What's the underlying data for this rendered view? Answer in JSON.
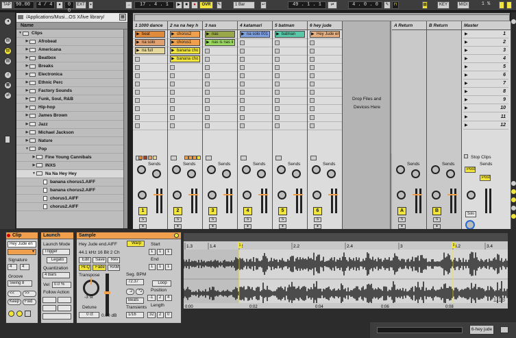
{
  "transport": {
    "tap": "TAP",
    "tempo": "90.00",
    "signature": "4 / 4",
    "metro_icon": "metronome-icon",
    "follow": "0 0",
    "ext": "EXT",
    "arr_position": "17 .  4 .  1",
    "ovr": "OVR",
    "quantize": "1 Bar",
    "loop_start": "49 .  1 .  1",
    "loop_len": "4 .  0 .  0",
    "key": "KEY",
    "midi": "MIDI",
    "cpu": "1 %",
    "colors": {
      "accent": "#f1e43c",
      "orange": "#f0a04c",
      "mixer_bg": "#9e9e9e"
    }
  },
  "browser": {
    "path": "/Applications/Musi...OS X/live library/",
    "column_header": "Name",
    "items": [
      {
        "label": "Clips",
        "type": "folder",
        "level": 0,
        "open": true
      },
      {
        "label": "Afrobeat",
        "type": "folder",
        "level": 1,
        "open": false
      },
      {
        "label": "Americana",
        "type": "folder",
        "level": 1,
        "open": false
      },
      {
        "label": "Beatbox",
        "type": "folder",
        "level": 1,
        "open": false
      },
      {
        "label": "Breaks",
        "type": "folder",
        "level": 1,
        "open": false
      },
      {
        "label": "Electronica",
        "type": "folder",
        "level": 1,
        "open": false
      },
      {
        "label": "Ethnic Perc",
        "type": "folder",
        "level": 1,
        "open": false
      },
      {
        "label": "Factory Sounds",
        "type": "folder",
        "level": 1,
        "open": false
      },
      {
        "label": "Funk, Soul, R&B",
        "type": "folder",
        "level": 1,
        "open": false
      },
      {
        "label": "Hip-hop",
        "type": "folder",
        "level": 1,
        "open": false
      },
      {
        "label": "James Brown",
        "type": "folder",
        "level": 1,
        "open": false
      },
      {
        "label": "Jazz",
        "type": "folder",
        "level": 1,
        "open": false
      },
      {
        "label": "Michael Jackson",
        "type": "folder",
        "level": 1,
        "open": false
      },
      {
        "label": "Nature",
        "type": "folder",
        "level": 1,
        "open": false
      },
      {
        "label": "Pop",
        "type": "folder",
        "level": 1,
        "open": true
      },
      {
        "label": "Fine Young Cannibals",
        "type": "folder",
        "level": 2,
        "open": false
      },
      {
        "label": "INXS",
        "type": "folder",
        "level": 2,
        "open": false
      },
      {
        "label": "Na Na Hey Hey",
        "type": "folder",
        "level": 2,
        "open": true,
        "selected": true
      },
      {
        "label": "banana chorus1.AIFF",
        "type": "file",
        "level": 3
      },
      {
        "label": "banana chorus2.AIFF",
        "type": "file",
        "level": 3
      },
      {
        "label": "chorus1.AIFF",
        "type": "file",
        "level": 3
      },
      {
        "label": "chorus2.AIFF",
        "type": "file",
        "level": 3
      }
    ]
  },
  "session": {
    "tracks": [
      {
        "name": "1 1000 dance",
        "num": "1",
        "clips": [
          {
            "label": "beat",
            "color": "#e08a3c"
          },
          {
            "label": "na solo",
            "color": "#e0a070"
          },
          {
            "label": "na full",
            "color": "#e6d89a"
          }
        ]
      },
      {
        "name": "2 na na hey h",
        "num": "2",
        "clips": [
          {
            "label": "chorus2",
            "color": "#f0a04c"
          },
          {
            "label": "chorus1",
            "color": "#f0a04c"
          },
          {
            "label": "banana cho",
            "color": "#f1e43c"
          },
          {
            "label": "banana cho",
            "color": "#f1e43c"
          }
        ]
      },
      {
        "name": "3 nas",
        "num": "3",
        "clips": [
          {
            "label": "nas",
            "color": "#9aa84a"
          },
          {
            "label": "nas is nas ii",
            "color": "#9ad860"
          }
        ]
      },
      {
        "name": "4 katamari",
        "num": "4",
        "clips": [
          {
            "label": "na solo 001",
            "color": "#7fa0e0"
          }
        ]
      },
      {
        "name": "5 batman",
        "num": "5",
        "clips": [
          {
            "label": "batman",
            "color": "#58c8a8"
          }
        ]
      },
      {
        "name": "6 hey jude",
        "num": "6",
        "clips": [
          {
            "label": "Hey Jude en",
            "color": "#e8b080"
          }
        ]
      }
    ],
    "drop_text_1": "Drop Files and",
    "drop_text_2": "Devices Here",
    "returns": [
      {
        "name": "A Return",
        "letter": "A"
      },
      {
        "name": "B Return",
        "letter": "B"
      }
    ],
    "master": {
      "name": "Master",
      "scenes": [
        "1",
        "2",
        "3",
        "4",
        "5",
        "6",
        "7",
        "8",
        "9",
        "10",
        "11",
        "12"
      ],
      "stop_clips": "Stop Clips",
      "post1": "Post",
      "post2": "Post",
      "solo": "Solo"
    },
    "sends_label": "Sends",
    "s_label": "S"
  },
  "clip": {
    "title": "Clip",
    "name": "Hey Jude en",
    "signature_label": "Signature",
    "sig_num": "4",
    "sig_den": "4",
    "groove_label": "Groove",
    "groove": "Swing 8",
    "nav_left": "<<",
    "nav_right": ">>",
    "keep": "Keep",
    "fwd": "Fwd"
  },
  "launch": {
    "title": "Launch",
    "mode_label": "Launch Mode",
    "mode": "Trigger",
    "legato": "Legato",
    "quant_label": "Quantization",
    "quant": "4 Bars",
    "vel_label": "Vel",
    "vel": "0.0 %",
    "follow_label": "Follow Action"
  },
  "sample": {
    "title": "Sample",
    "file": "Hey Jude end.AIFF",
    "info": "44.1 kHz 16 Bit 2 Ch",
    "warp": "Warp",
    "edit": "Edit",
    "save": "Save",
    "rev": "Rev",
    "hiq": "Hi-Q",
    "fade": "Fade",
    "ram": "RAM",
    "transpose_label": "Transpose",
    "transpose": "-3 st",
    "detune_label": "Detune",
    "detune": "0 ct",
    "gain": "0.00 dB",
    "start_label": "Start",
    "start_vals": [
      "1",
      "1",
      "1"
    ],
    "end_label": "End",
    "end_vals": [
      "1",
      "1",
      "1"
    ],
    "segbpm_label": "Seg. BPM",
    "segbpm": "72.37",
    "half": ":2",
    "double": "*2",
    "mode": "Beats",
    "transients_label": "Transients",
    "transients": "1/16",
    "loop": "Loop",
    "position_label": "Position",
    "position_vals": [
      "-1",
      "2",
      "4"
    ],
    "length_label": "Length",
    "length_vals": [
      "32",
      "2",
      "0"
    ]
  },
  "waveform": {
    "ruler": [
      "1.3",
      "1.4",
      "2",
      "2.2",
      "2.4",
      "3",
      "3.2",
      "3.4"
    ],
    "time": [
      "0:00",
      "0:02",
      "0:04",
      "0:06",
      "0:08"
    ],
    "marker_start": "1",
    "marker_end": "3",
    "zoom": "1/16"
  },
  "status": {
    "track": "6-hey jude"
  }
}
